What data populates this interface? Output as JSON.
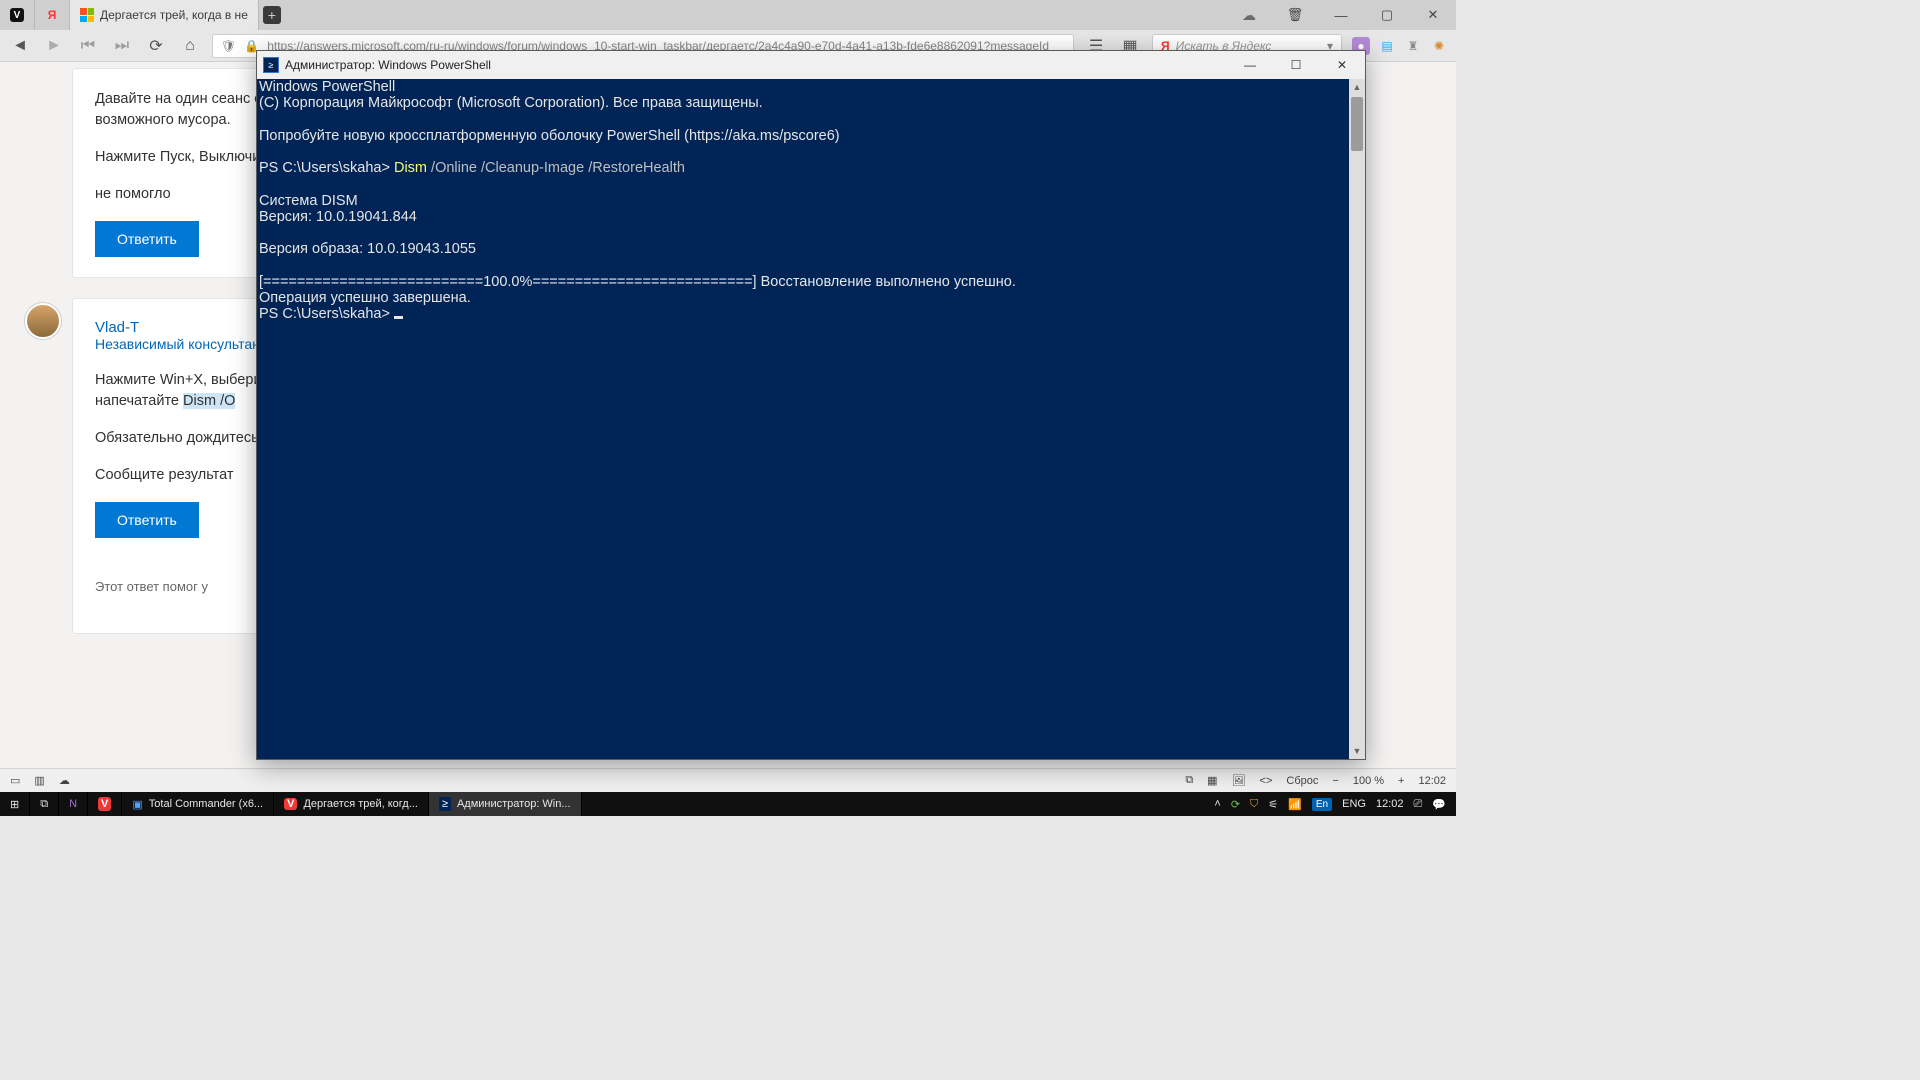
{
  "browser": {
    "tabs": [
      {
        "label": "",
        "kind": "vivaldi"
      },
      {
        "label": "",
        "kind": "yandex"
      },
      {
        "label": "Дергается трей, когда в не",
        "kind": "ms",
        "active": true
      }
    ],
    "url": "https://answers.microsoft.com/ru-ru/windows/forum/windows_10-start-win_taskbar/дергаетс/2a4c4a90-e70d-4a41-a13b-fde6e8862091?messageId",
    "search_placeholder": "Искать в Яндекс",
    "status": {
      "reset": "Сброс",
      "zoom": "100 %",
      "clock": "12:02"
    }
  },
  "page": {
    "card1": {
      "l1": "Давайте на один сеанс отключим Защитник W",
      "l2": "возможного мусора.",
      "l3": "Нажмите Пуск, Выключить",
      "l4": "не помогло",
      "reply": "Ответить"
    },
    "card2": {
      "user": "Vlad-T",
      "role": "Независимый консультант",
      "p1a": "Нажмите Win+X, выберите",
      "p1b": "напечатайте ",
      "hl": "Dism /O",
      "p2": "Обязательно дождитесь завершения",
      "p3": "Сообщите результат",
      "reply": "Ответить",
      "help": "Этот ответ помог у"
    }
  },
  "powershell": {
    "title": "Администратор: Windows PowerShell",
    "lines": {
      "a": "Windows PowerShell",
      "b": "(C) Корпорация Майкрософт (Microsoft Corporation). Все права защищены.",
      "c": "Попробуйте новую кроссплатформенную оболочку PowerShell (https://aka.ms/pscore6)",
      "d_prompt": "PS C:\\Users\\skaha> ",
      "d_cmd": "Dism",
      "d_args": " /Online /Cleanup-Image /RestoreHealth",
      "e": "Cистема DISM",
      "f": "Версия: 10.0.19041.844",
      "g": "Версия образа: 10.0.19043.1055",
      "h": "[==========================100.0%==========================] Восстановление выполнено успешно.",
      "i": "Операция успешно завершена.",
      "j": "PS C:\\Users\\skaha> "
    }
  },
  "taskbar": {
    "apps": [
      {
        "label": "Total Commander (x6..."
      },
      {
        "label": "Дергается трей, когд..."
      },
      {
        "label": "Администратор: Win...",
        "active": true
      }
    ],
    "lang_badge": "En",
    "lang": "ENG",
    "clock": "12:02"
  }
}
